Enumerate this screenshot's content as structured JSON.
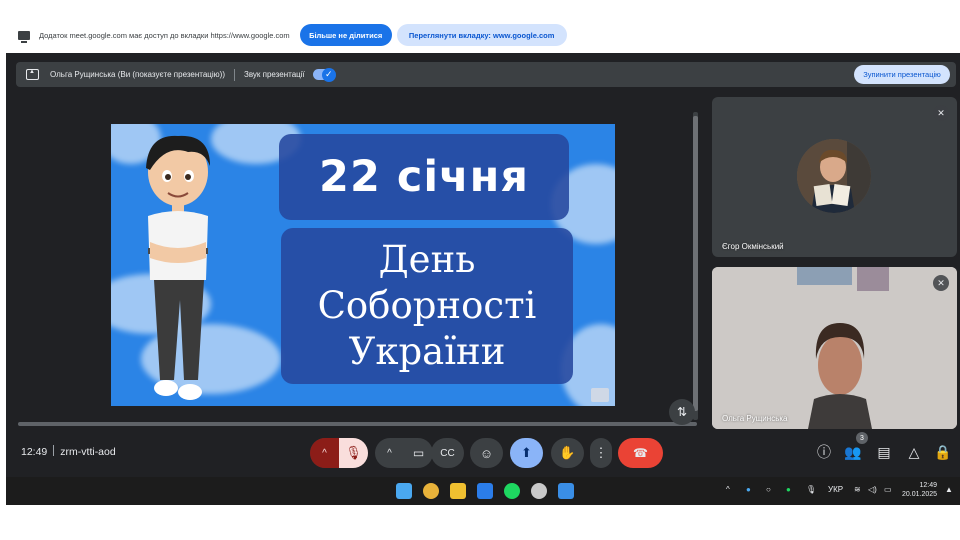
{
  "share_bar": {
    "message": "Додаток meet.google.com має доступ до вкладки https://www.google.com",
    "stop_sharing_label": "Більше не ділитися",
    "view_tab_label": "Переглянути вкладку: www.google.com"
  },
  "presenter_bar": {
    "presenter_text": "Ольга Рущинська (Ви (показуєте презентацію))",
    "audio_label": "Звук презентації",
    "stop_presenting_label": "Зупинити презентацію"
  },
  "slide": {
    "line1": "22 січня",
    "line2": "День",
    "line3": "Соборності",
    "line4": "України"
  },
  "participants": [
    {
      "name": "Єгор Окмінський",
      "muted": true
    },
    {
      "name": "Ольга Рущинська",
      "muted": true
    }
  ],
  "meeting": {
    "time": "12:49",
    "code": "zrm-vtti-aod",
    "participant_count": "3"
  },
  "taskbar": {
    "language": "УКР",
    "clock_time": "12:49",
    "clock_date": "20.01.2025"
  },
  "colors": {
    "end_call": "#ea4335",
    "muted_mic": "#f9dedc",
    "mic_caret": "#8c1d18",
    "present_active": "#8ab4f8",
    "accent_blue": "#1a73e8"
  }
}
